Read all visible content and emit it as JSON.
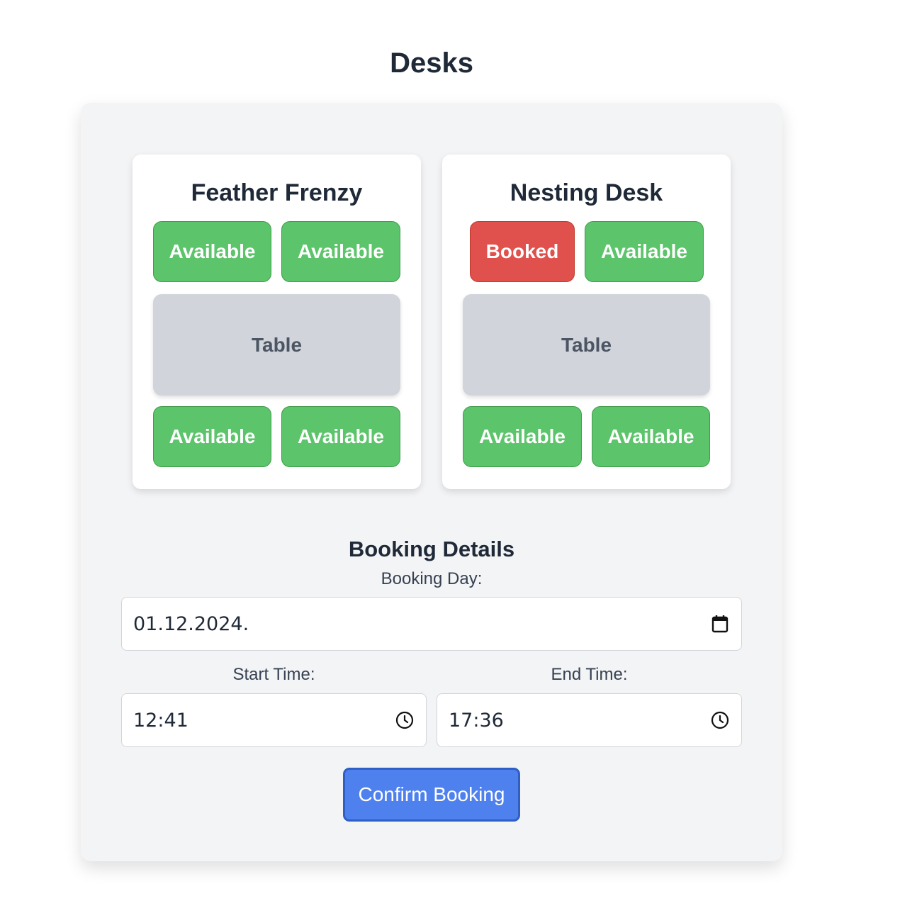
{
  "page": {
    "title": "Desks"
  },
  "desks": [
    {
      "name": "Feather Frenzy",
      "seats_top": [
        "Available",
        "Available"
      ],
      "table_label": "Table",
      "seats_bottom": [
        "Available",
        "Available"
      ]
    },
    {
      "name": "Nesting Desk",
      "seats_top": [
        "Booked",
        "Available"
      ],
      "table_label": "Table",
      "seats_bottom": [
        "Available",
        "Available"
      ]
    }
  ],
  "booking": {
    "title": "Booking Details",
    "day_label": "Booking Day:",
    "day_value": "01.12.2024.",
    "start_label": "Start Time:",
    "start_value": "12:41",
    "end_label": "End Time:",
    "end_value": "17:36",
    "confirm_label": "Confirm Booking"
  },
  "colors": {
    "available": "#5cc46a",
    "booked": "#e0504c",
    "table": "#d1d5db",
    "primary": "#4f81ee"
  },
  "icons": {
    "day": "calendar-icon",
    "start": "clock-icon",
    "end": "clock-icon"
  }
}
